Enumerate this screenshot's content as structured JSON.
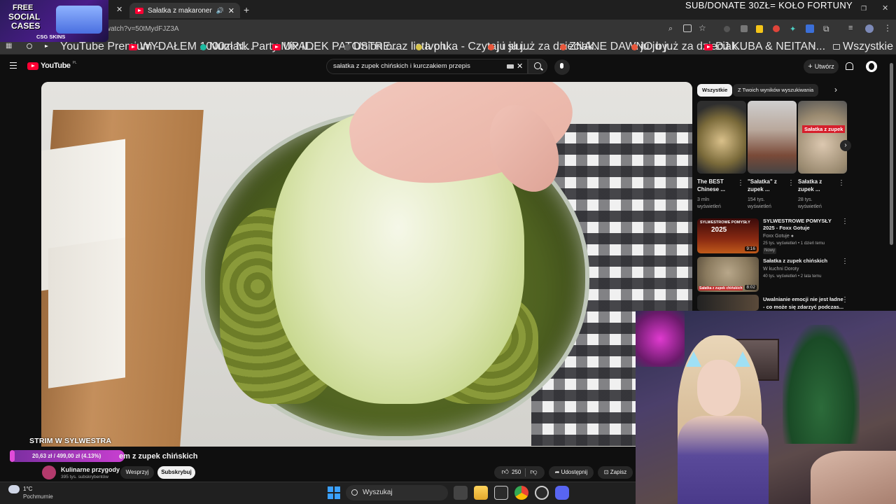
{
  "browser": {
    "active_tab_title": "Sałatka z makaronem z zup",
    "url_fragment": "/watch?v=50tMydFJZ3A",
    "bookmarks": [
      "YouTube Premium -...",
      "WYDAŁEM 1000zł N...",
      "Numark Party Mix II...",
      "UPADEK PATOSTRE...",
      "Union oraz lista plu...",
      "Ivonka - Czytaj i słu...",
      "ju ju już za dzieciak...",
      "ZNANE DAWNO by...",
      "ju ju już za dzieciak...",
      "DJ KUBA & NEITAN..."
    ],
    "all_bookmarks_label": "Wszystkie zakładki"
  },
  "overlay": {
    "cases_line1": "FREE",
    "cases_line2": "SOCIAL",
    "cases_line3": "CASES",
    "cases_brand": "CSG SKINS",
    "stream_banner": "SUB/DONATE 30ZŁ= KOŁO FORTUNY",
    "strim_label": "STRIM W SYLWESTRA",
    "donate_goal": "20,63 zł / 499,00 zł (4.13%)",
    "donate_goal_percent": 4.13
  },
  "youtube": {
    "logo_text": "YouTube",
    "logo_country": "PL",
    "search_value": "sałatka z zupek chińskich i kurczakiem przepis",
    "create_label": "Utwórz",
    "video_title_visible": "em z zupek chińskich",
    "channel_name": "Kulinarne przygody",
    "channel_subs": "395 tys. subskrybentów",
    "support_label": "Wesprzyj",
    "subscribe_label": "Subskrybuj",
    "like_count": "250",
    "share_label": "Udostępnij",
    "save_label": "Zapisz"
  },
  "sidebar": {
    "chips": [
      "Wszystkie",
      "Z Twoich wyników wyszukiwania"
    ],
    "shorts": [
      {
        "title": "The BEST Chinese ...",
        "views_line1": "3 mln",
        "views_line2": "wyświetleń"
      },
      {
        "title": "\"Sałatka\" z zupek ...",
        "views_line1": "154 tys.",
        "views_line2": "wyświetleń"
      },
      {
        "title": "Sałatka z zupek ...",
        "views_line1": "28 tys.",
        "views_line2": "wyświetleń"
      }
    ],
    "short3_overlay": "Sałatka z zupek",
    "videos": [
      {
        "title_l1": "SYLWESTROWE POMYSŁY",
        "title_l2": "2025 - Foxx Gotuje",
        "channel": "Foxx Gotuje",
        "meta": "25 tys. wyświetleń • 1 dzień temu",
        "badge": "Nowy",
        "duration": "9:16",
        "thumb_text": "SYLWESTROWE POMYSŁY",
        "thumb_year": "2025"
      },
      {
        "title_l1": "Sałatka z zupek chińskich",
        "title_l2": "",
        "channel": "W kuchni Doroty",
        "meta": "40 tys. wyświetleń • 2 lata temu",
        "badge": "",
        "duration": "8:02",
        "thumb_text": "Sałatka z zupek chińskich",
        "thumb_year": ""
      },
      {
        "title_l1": "Uwalnianie emocji nie jest ładne",
        "title_l2": "- co może się zdarzyć podczas...",
        "channel": "",
        "meta": "",
        "badge": "",
        "duration": "",
        "thumb_text": "",
        "thumb_year": ""
      }
    ]
  },
  "taskbar": {
    "weather_temp": "1°C",
    "weather_desc": "Pochmurnie",
    "search_label": "Wyszukaj"
  },
  "colors": {
    "yt_red": "#ff0033",
    "bg": "#0f0f0f",
    "accent_purple": "#c83fd0"
  }
}
